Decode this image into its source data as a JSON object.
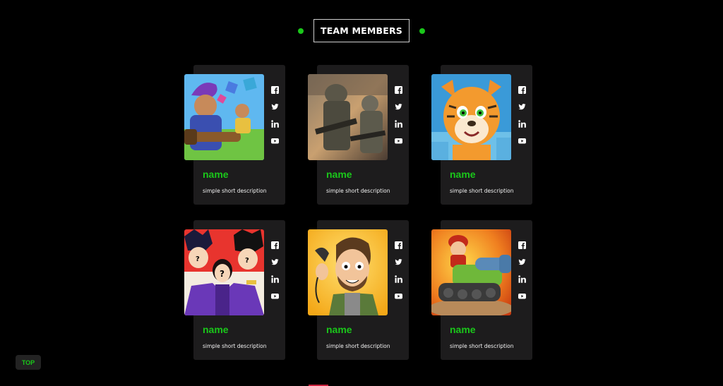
{
  "header": {
    "title": "TEAM MEMBERS",
    "accent": "#1ac71a"
  },
  "members": [
    {
      "name": "name",
      "description": "simple short description",
      "avatar": "cartoon-hero-with-bazooka"
    },
    {
      "name": "name",
      "description": "simple short description",
      "avatar": "soldiers-with-rifles"
    },
    {
      "name": "name",
      "description": "simple short description",
      "avatar": "cartoon-tiger"
    },
    {
      "name": "name",
      "description": "simple short description",
      "avatar": "anime-characters-faceless"
    },
    {
      "name": "name",
      "description": "simple short description",
      "avatar": "cartoon-man-on-phone"
    },
    {
      "name": "name",
      "description": "simple short description",
      "avatar": "cartoon-tank-soldier"
    }
  ],
  "social_icons": [
    "facebook-icon",
    "twitter-icon",
    "linkedin-icon",
    "youtube-icon"
  ],
  "top_button": {
    "label": "TOP"
  }
}
